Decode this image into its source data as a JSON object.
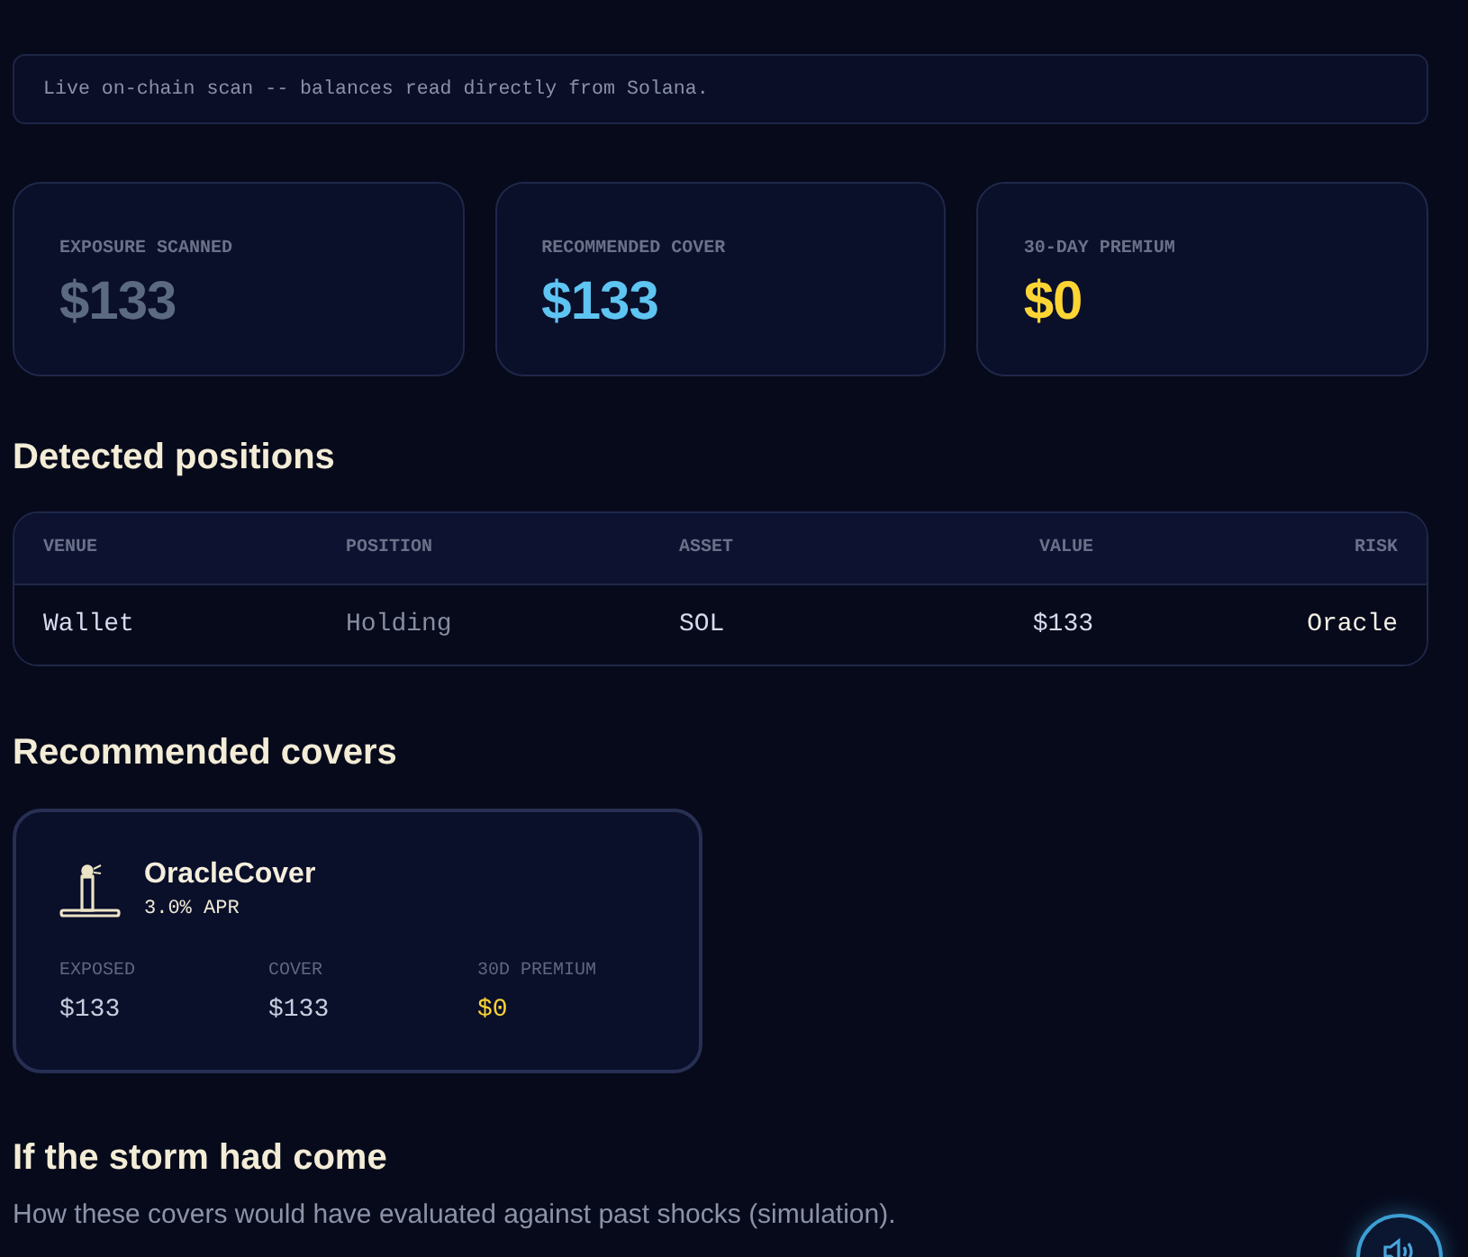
{
  "notice": {
    "text": "Live on-chain scan -- balances read directly from Solana."
  },
  "stats": [
    {
      "label": "EXPOSURE SCANNED",
      "value": "$133",
      "color": "#5b6a80"
    },
    {
      "label": "RECOMMENDED COVER",
      "value": "$133",
      "color": "#5ec4f2"
    },
    {
      "label": "30-DAY PREMIUM",
      "value": "$0",
      "color": "#fcd535"
    }
  ],
  "positions": {
    "title": "Detected positions",
    "columns": [
      "VENUE",
      "POSITION",
      "ASSET",
      "VALUE",
      "RISK"
    ],
    "rows": [
      {
        "cells": [
          "Wallet",
          "Holding",
          "SOL",
          "$133",
          "Oracle"
        ]
      }
    ]
  },
  "covers": {
    "title": "Recommended covers",
    "items": [
      {
        "name": "OracleCover",
        "rate": "3.0% APR",
        "stats": [
          {
            "label": "EXPOSED",
            "value": "$133",
            "highlight": false
          },
          {
            "label": "COVER",
            "value": "$133",
            "highlight": false
          },
          {
            "label": "30D PREMIUM",
            "value": "$0",
            "highlight": true
          }
        ]
      }
    ]
  },
  "simulation": {
    "title": "If the storm had come",
    "description": "How these covers would have evaluated against past shocks (simulation)."
  }
}
